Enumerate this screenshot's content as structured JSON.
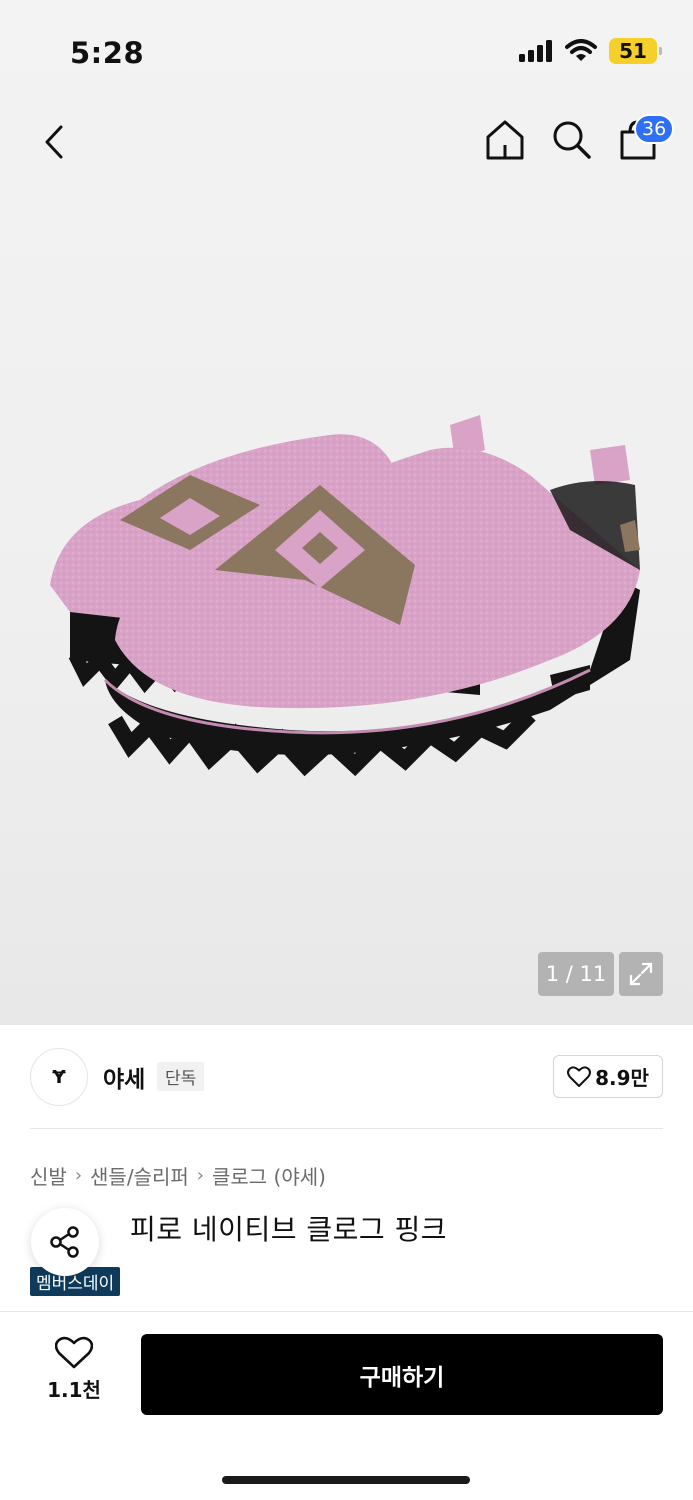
{
  "status_bar": {
    "time": "5:28",
    "battery": "51"
  },
  "nav": {
    "cart_count": "36",
    "icons": [
      "back-icon",
      "home-icon",
      "search-icon",
      "bag-icon"
    ]
  },
  "gallery": {
    "counter": "1 / 11"
  },
  "brand": {
    "logo_text": "Ɏ",
    "name": "야세",
    "tag": "단독",
    "likes": "8.9만"
  },
  "breadcrumb": [
    "신발",
    "샌들/슬리퍼",
    "클로그 (야세)"
  ],
  "product": {
    "title": "피로 네이티브 클로그 핑크",
    "promo": "멤버스데이"
  },
  "bottom": {
    "wish_count": "1.1천",
    "buy_label": "구매하기"
  },
  "colors": {
    "buy_button": "#000000",
    "badge_blue": "#2f6ff5",
    "promo_navy": "#0e3b5b",
    "battery": "#f5cf2a"
  }
}
